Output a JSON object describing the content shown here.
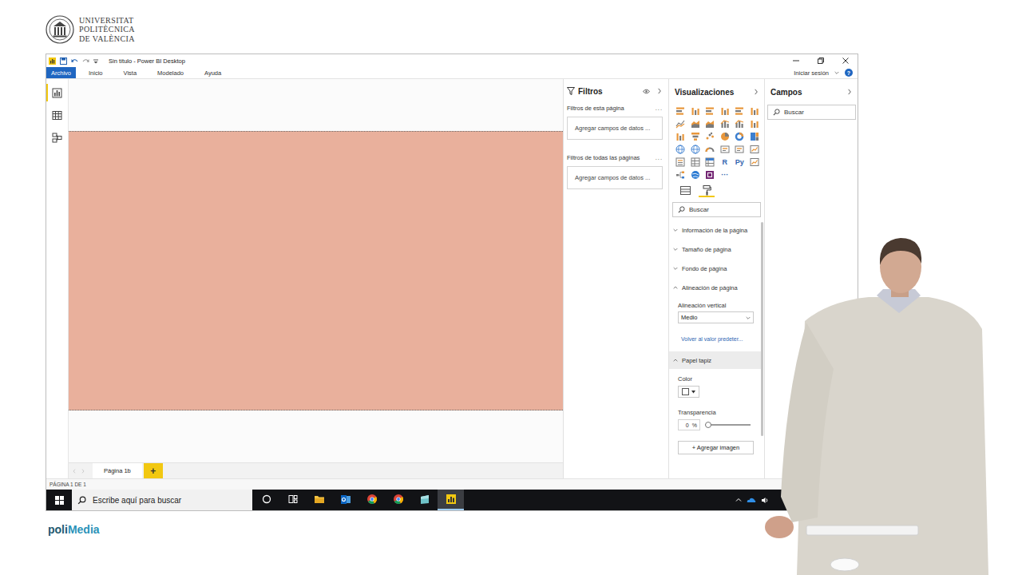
{
  "branding": {
    "university": [
      "UNIVERSITAT",
      "POLITÈCNICA",
      "DE VALÈNCIA"
    ],
    "platform": {
      "lead": "poli",
      "tail": "Media"
    }
  },
  "window": {
    "title": "Sin título - Power BI Desktop"
  },
  "menu": [
    {
      "label": "Archivo",
      "kind": "file"
    },
    {
      "label": "Inicio",
      "kind": "tab"
    },
    {
      "label": "Vista",
      "kind": "tab"
    },
    {
      "label": "Modelado",
      "kind": "tab"
    },
    {
      "label": "Ayuda",
      "kind": "tab"
    }
  ],
  "account": {
    "sign_in": "Iniciar sesión",
    "help": "?"
  },
  "nav": [
    {
      "kind": "report",
      "selected": true
    },
    {
      "kind": "data",
      "selected": false
    },
    {
      "kind": "model",
      "selected": false
    }
  ],
  "pages": [
    {
      "label": "Página 1b",
      "selected": true
    }
  ],
  "add_page": "+",
  "status_bar": "PÁGINA 1 DE 1",
  "filters": {
    "title": "Filtros",
    "sections": [
      {
        "label": "Filtros de esta página",
        "more": "...",
        "placeholder": "Agregar campos de datos ..."
      },
      {
        "label": "Filtros de todas las páginas",
        "more": "...",
        "placeholder": "Agregar campos de datos ..."
      }
    ]
  },
  "visualizations": {
    "title": "Visualizaciones",
    "icons": [
      {
        "kind": "hbar"
      },
      {
        "kind": "vbar"
      },
      {
        "kind": "hbar"
      },
      {
        "kind": "vbar"
      },
      {
        "kind": "hbar"
      },
      {
        "kind": "vbar"
      },
      {
        "kind": "line"
      },
      {
        "kind": "area"
      },
      {
        "kind": "area"
      },
      {
        "kind": "combo"
      },
      {
        "kind": "combo"
      },
      {
        "kind": "vbar"
      },
      {
        "kind": "vbar"
      },
      {
        "kind": "funnel"
      },
      {
        "kind": "scatter"
      },
      {
        "kind": "pie"
      },
      {
        "kind": "donut"
      },
      {
        "kind": "treemap"
      },
      {
        "kind": "map"
      },
      {
        "kind": "map"
      },
      {
        "kind": "gauge"
      },
      {
        "kind": "card"
      },
      {
        "kind": "card"
      },
      {
        "kind": "kpi"
      },
      {
        "kind": "slicer"
      },
      {
        "kind": "table"
      },
      {
        "kind": "matrix"
      },
      {
        "kind": "glyph",
        "text": "R"
      },
      {
        "kind": "glyph",
        "text": "Py"
      },
      {
        "kind": "kpi"
      },
      {
        "kind": "tree"
      },
      {
        "kind": "globe"
      },
      {
        "kind": "app"
      },
      {
        "kind": "glyph",
        "text": "···"
      }
    ],
    "tabs": [
      {
        "kind": "fields",
        "selected": false
      },
      {
        "kind": "format",
        "selected": true
      }
    ],
    "search": "Buscar",
    "sections": [
      {
        "label": "Información de la página",
        "expanded": false,
        "highlighted": false,
        "fields": []
      },
      {
        "label": "Tamaño de página",
        "expanded": false,
        "highlighted": false,
        "fields": []
      },
      {
        "label": "Fondo de página",
        "expanded": false,
        "highlighted": false,
        "fields": []
      },
      {
        "label": "Alineación de página",
        "expanded": true,
        "highlighted": false,
        "fields": [
          {
            "kind": "dropdown",
            "label": "Alineación vertical",
            "value": "Medio"
          },
          {
            "kind": "link",
            "text": "Volver al valor predeter..."
          }
        ]
      },
      {
        "label": "Papel tapiz",
        "expanded": true,
        "highlighted": true,
        "fields": [
          {
            "kind": "color",
            "label": "Color",
            "value": "#ffffff"
          },
          {
            "kind": "slider",
            "label": "Transparencia",
            "value": "0",
            "unit": "%",
            "level": 0
          },
          {
            "kind": "button",
            "text": "+ Agregar imagen"
          }
        ]
      }
    ]
  },
  "fields": {
    "title": "Campos",
    "search": "Buscar"
  },
  "taskbar": {
    "search": "Escribe aquí para buscar",
    "apps": [
      {
        "kind": "cortana",
        "selected": false
      },
      {
        "kind": "taskview",
        "selected": false
      },
      {
        "kind": "explorer",
        "selected": false
      },
      {
        "kind": "outlook",
        "selected": false
      },
      {
        "kind": "chrome",
        "selected": false
      },
      {
        "kind": "chrome",
        "selected": false
      },
      {
        "kind": "app",
        "selected": false
      },
      {
        "kind": "powerbi",
        "selected": true
      }
    ],
    "tray": [
      {
        "kind": "up"
      },
      {
        "kind": "cloud"
      },
      {
        "kind": "speaker"
      }
    ]
  }
}
